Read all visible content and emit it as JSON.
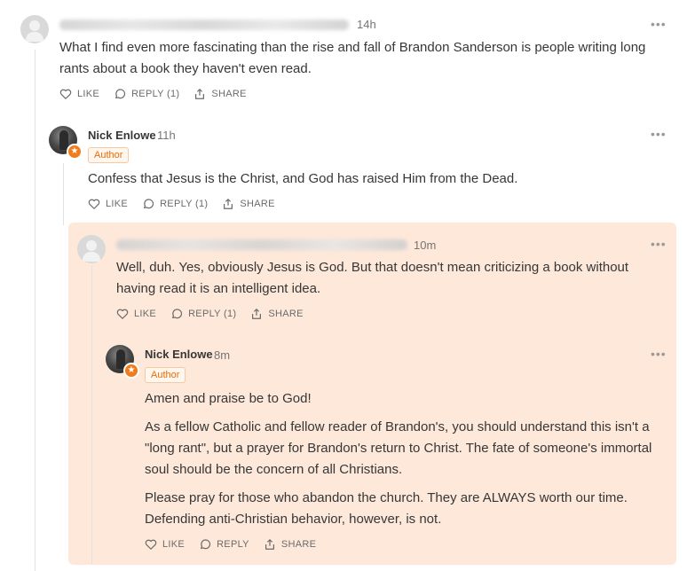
{
  "comments": [
    {
      "author_blurred": true,
      "time": "14h",
      "more": "•••",
      "text": "What I find even more fascinating than the rise and fall of Brandon Sanderson is people writing long rants about a book they haven't even read.",
      "actions": {
        "like": "LIKE",
        "reply": "REPLY (1)",
        "share": "SHARE"
      }
    },
    {
      "author": "Nick Enlowe",
      "time": "11h",
      "badge": "Author",
      "more": "•••",
      "avatar_badge_icon": "star-icon",
      "text": "Confess that Jesus is the Christ, and God has raised Him from the Dead.",
      "actions": {
        "like": "LIKE",
        "reply": "REPLY (1)",
        "share": "SHARE"
      }
    },
    {
      "author_blurred": true,
      "time": "10m",
      "more": "•••",
      "text": "Well, duh. Yes, obviously Jesus is God. But that doesn't mean criticizing a book without having read it is an intelligent idea.",
      "actions": {
        "like": "LIKE",
        "reply": "REPLY (1)",
        "share": "SHARE"
      }
    },
    {
      "author": "Nick Enlowe",
      "time": "8m",
      "badge": "Author",
      "more": "•••",
      "avatar_badge_icon": "star-icon",
      "paragraphs": [
        "Amen and praise be to God!",
        "As a fellow Catholic and fellow reader of Brandon's, you should understand this isn't a \"long rant\", but a prayer for Brandon's return to Christ. The fate of someone's immortal soul should be the concern of all Christians.",
        "Please pray for those who abandon the church. They are ALWAYS worth our time. Defending anti-Christian behavior, however, is not."
      ],
      "actions": {
        "like": "LIKE",
        "reply": "REPLY",
        "share": "SHARE"
      }
    }
  ],
  "colors": {
    "highlight_bg": "#fde8da",
    "author_badge": "#e86c0a",
    "avatar_star": "#f07c1b"
  }
}
